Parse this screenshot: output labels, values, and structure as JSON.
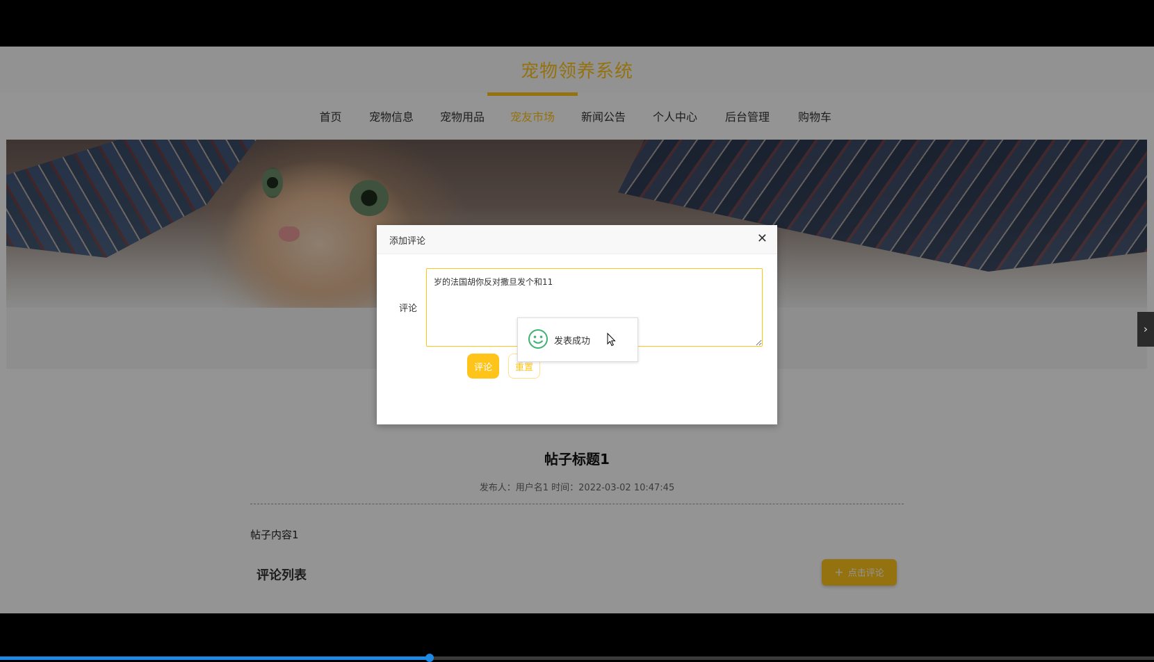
{
  "site": {
    "title": "宠物领养系统"
  },
  "nav": {
    "items": [
      {
        "label": "首页"
      },
      {
        "label": "宠物信息"
      },
      {
        "label": "宠物用品"
      },
      {
        "label": "宠友市场",
        "active": true
      },
      {
        "label": "新闻公告"
      },
      {
        "label": "个人中心"
      },
      {
        "label": "后台管理"
      },
      {
        "label": "购物车"
      }
    ]
  },
  "side_arrow": {
    "icon": "chevron-right-icon",
    "glyph": "›"
  },
  "post": {
    "title": "帖子标题1",
    "meta": "发布人：用户名1 时间：2022-03-02 10:47:45",
    "content": "帖子内容1",
    "comments_heading": "评论列表",
    "add_comment_label": "点击评论",
    "add_comment_icon": "plus-icon"
  },
  "dialog": {
    "title": "添加评论",
    "close_icon": "close-icon",
    "comment_label": "评论",
    "comment_value": "岁的法国胡你反对撒旦发个和11",
    "submit_label": "评论",
    "reset_label": "重置"
  },
  "toast": {
    "message": "发表成功",
    "icon": "smile-icon"
  },
  "video_progress": {
    "fraction": 0.372
  },
  "colors": {
    "accent": "#ffc41a",
    "success": "#3cb371",
    "overlay": "rgba(0,0,0,0.42)"
  }
}
